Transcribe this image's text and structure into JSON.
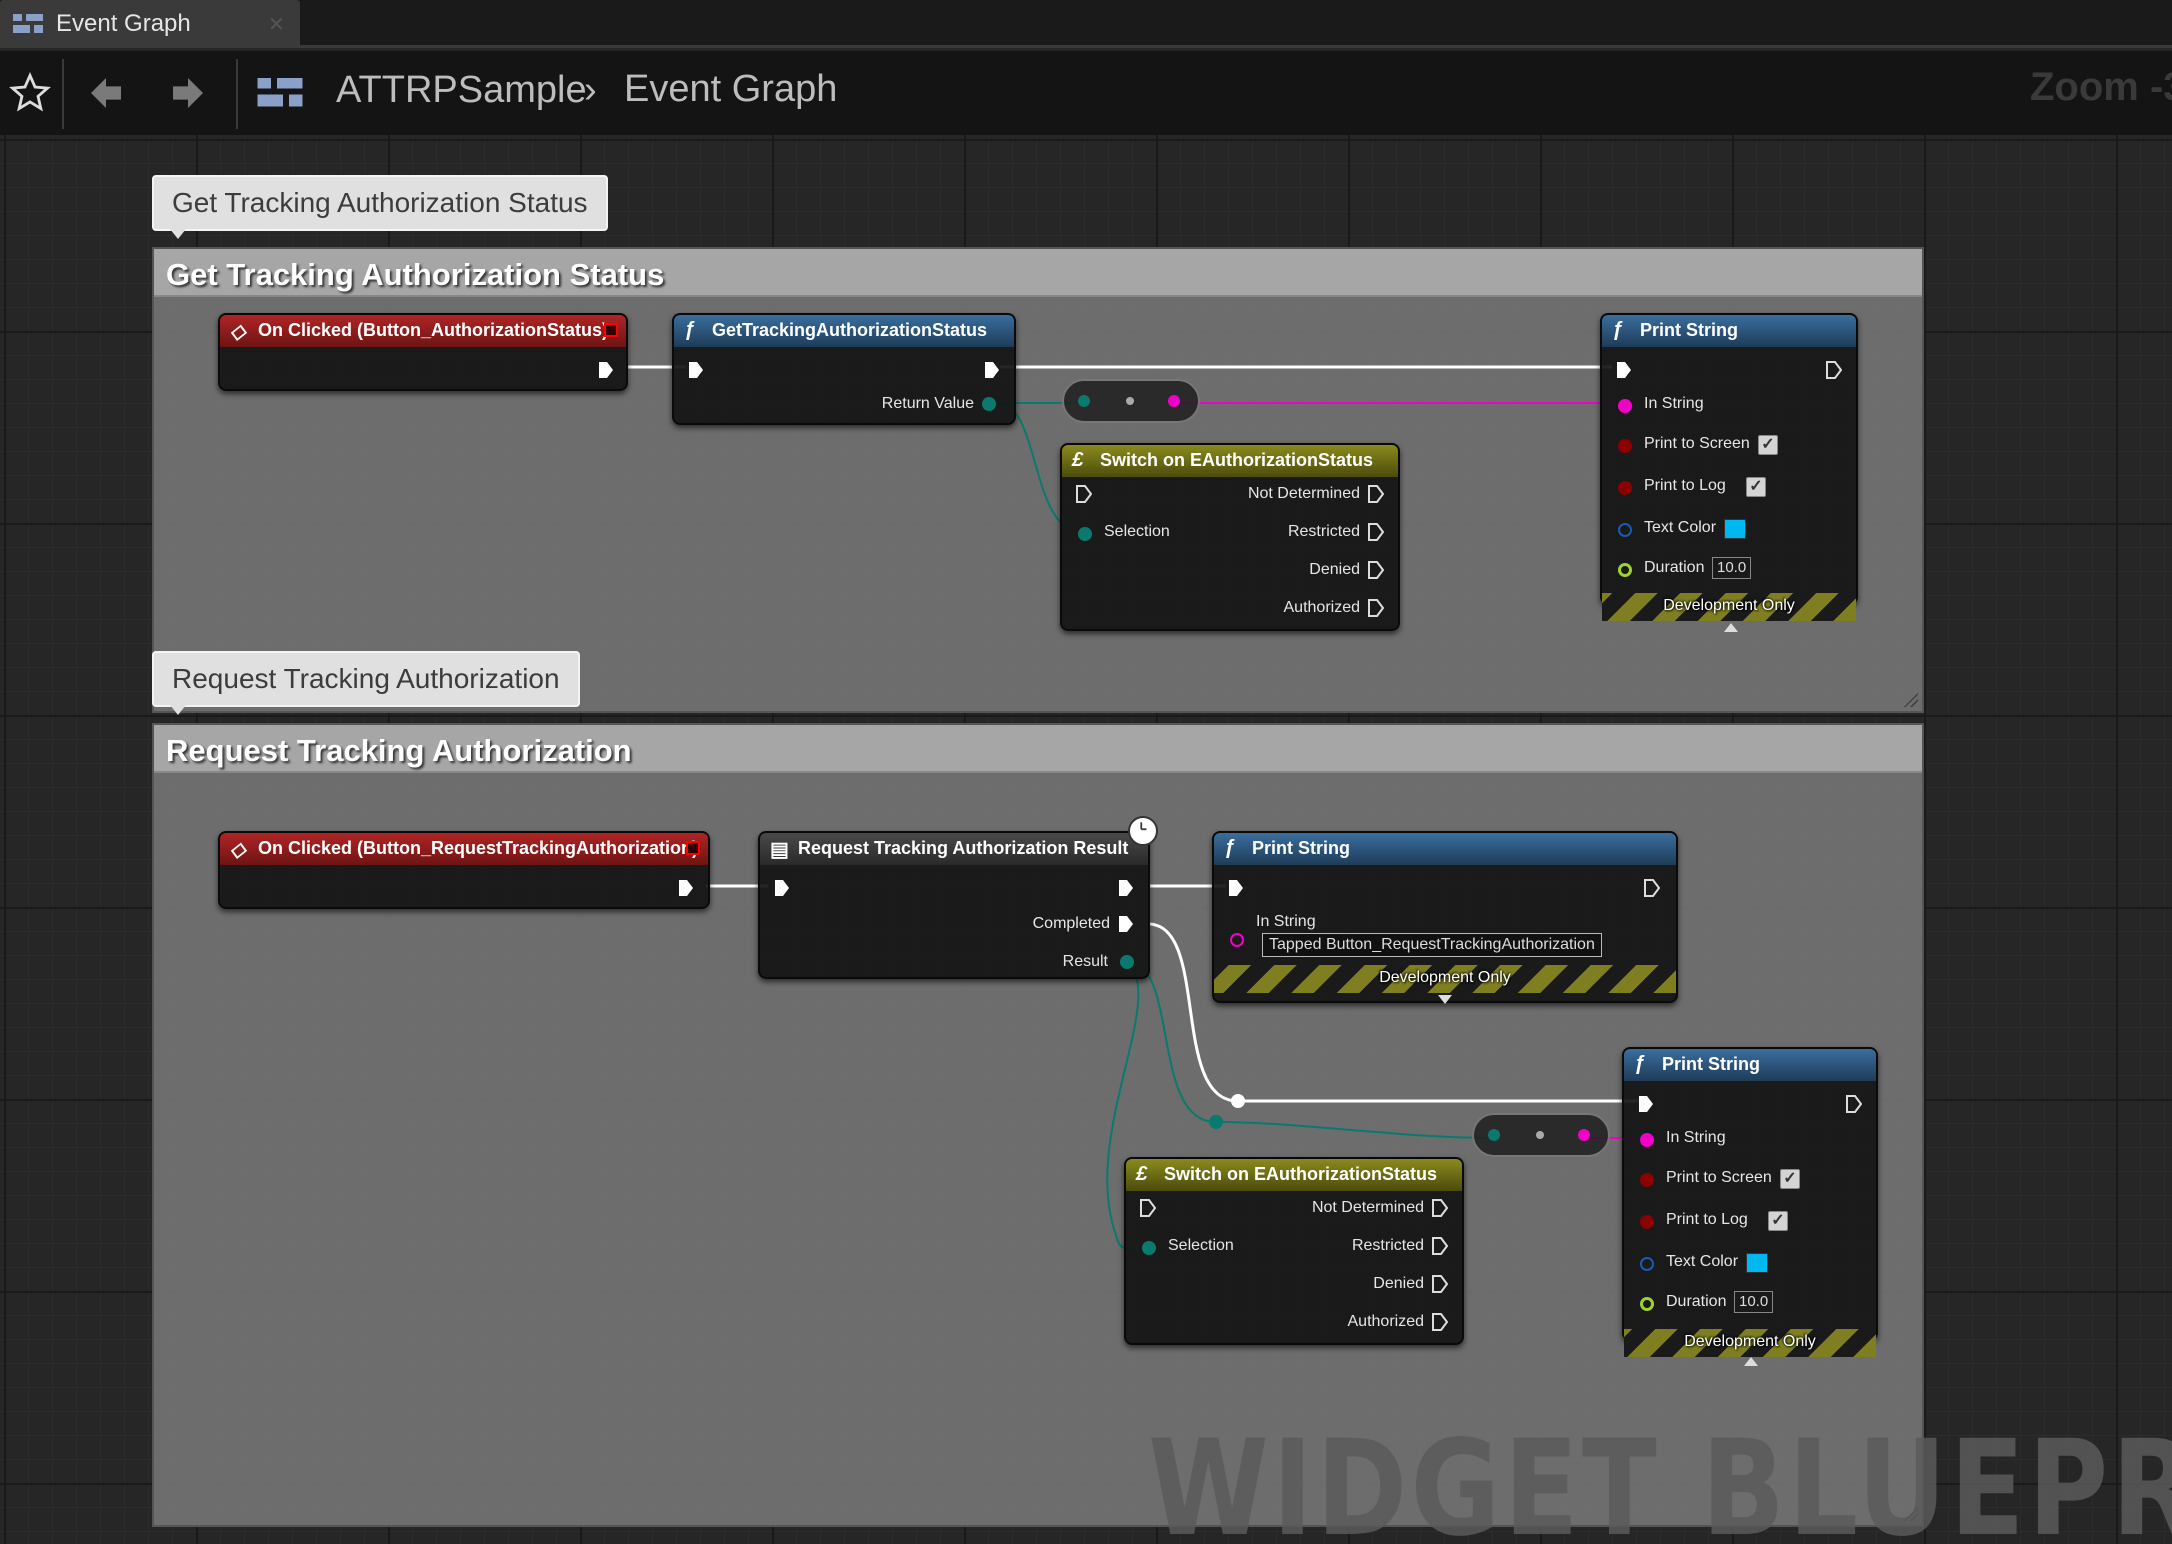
{
  "tab": {
    "label": "Event Graph"
  },
  "breadcrumb": {
    "app": "ATTRPSample",
    "separator": "›",
    "graph": "Event Graph"
  },
  "zoom": {
    "label": "Zoom -3"
  },
  "comments": [
    {
      "bubble": "Get Tracking Authorization Status",
      "header": "Get Tracking Authorization Status"
    },
    {
      "bubble": "Request Tracking Authorization",
      "header": "Request Tracking Authorization"
    }
  ],
  "section1": {
    "event": {
      "title": "On Clicked (Button_AuthorizationStatus)"
    },
    "getStatus": {
      "title": "GetTrackingAuthorizationStatus",
      "return_label": "Return Value"
    },
    "switch": {
      "title": "Switch on EAuthorizationStatus",
      "selection": "Selection",
      "cases": [
        "Not Determined",
        "Restricted",
        "Denied",
        "Authorized"
      ]
    },
    "print": {
      "title": "Print String",
      "in_string": "In String",
      "print_screen": "Print to Screen",
      "print_log": "Print to Log",
      "text_color": "Text Color",
      "duration": "Duration",
      "duration_value": "10.0",
      "dev_only": "Development Only"
    }
  },
  "section2": {
    "event": {
      "title": "On Clicked (Button_RequestTrackingAuthorization)"
    },
    "request": {
      "title": "Request Tracking Authorization Result",
      "completed": "Completed",
      "result": "Result"
    },
    "print1": {
      "title": "Print String",
      "in_string": "In String",
      "in_string_value": "Tapped  Button_RequestTrackingAuthorization",
      "dev_only": "Development Only"
    },
    "switch": {
      "title": "Switch on EAuthorizationStatus",
      "selection": "Selection",
      "cases": [
        "Not Determined",
        "Restricted",
        "Denied",
        "Authorized"
      ]
    },
    "print2": {
      "title": "Print String",
      "in_string": "In String",
      "print_screen": "Print to Screen",
      "print_log": "Print to Log",
      "text_color": "Text Color",
      "duration": "Duration",
      "duration_value": "10.0",
      "dev_only": "Development Only"
    }
  },
  "colors": {
    "exec": "#ffffff",
    "enum": "#0a7a6e",
    "string": "#f000c8",
    "bool": "#8c0000",
    "color": "#1a5ab8",
    "float": "#9ed32e",
    "text_color_value": "#00b8f0"
  },
  "watermark": "WIDGET BLUEPRINT"
}
